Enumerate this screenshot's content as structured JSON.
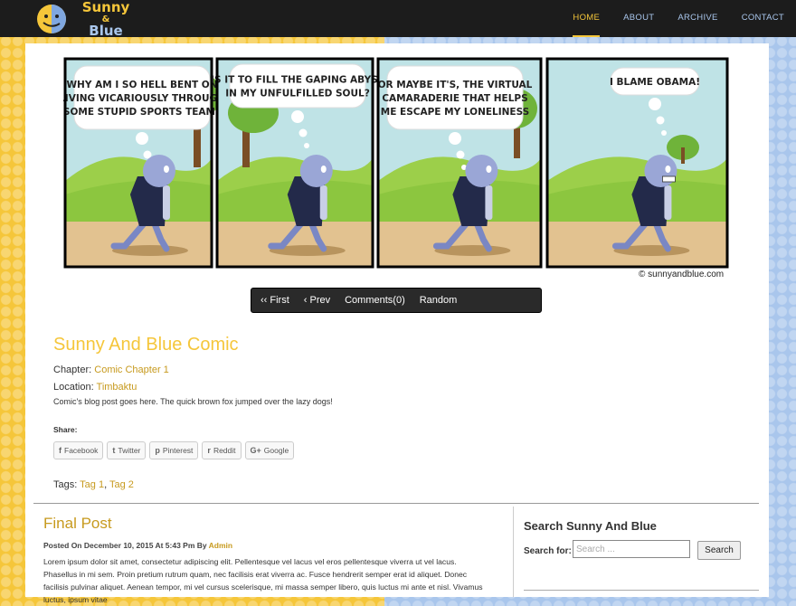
{
  "site": {
    "logo_line1": "Sunny",
    "logo_line2": "&",
    "logo_line3": "Blue"
  },
  "nav": {
    "items": [
      {
        "label": "HOME",
        "active": true
      },
      {
        "label": "ABOUT",
        "active": false
      },
      {
        "label": "ARCHIVE",
        "active": false
      },
      {
        "label": "CONTACT",
        "active": false
      }
    ]
  },
  "comic": {
    "panels": [
      {
        "lines": [
          "WHY AM I SO HELL BENT ON",
          "LIVING  VICARIOUSLY THROUGH",
          "SOME STUPID SPORTS TEAM?"
        ]
      },
      {
        "lines": [
          "IS IT TO FILL THE GAPING ABYSS",
          "IN MY UNFULFILLED SOUL?"
        ]
      },
      {
        "lines": [
          "OR MAYBE IT'S, THE VIRTUAL",
          "CAMARADERIE THAT HELPS",
          "ME ESCAPE MY LONELINESS"
        ]
      },
      {
        "lines": [
          "I BLAME OBAMA!"
        ]
      }
    ],
    "credit": "© sunnyandblue.com",
    "nav": {
      "first": "‹‹ First",
      "prev": "‹ Prev",
      "comments": "Comments(0)",
      "random": "Random"
    }
  },
  "post": {
    "title": "Sunny And Blue Comic",
    "chapter_label": "Chapter:",
    "chapter_value": "Comic Chapter 1",
    "location_label": "Location:",
    "location_value": "Timbaktu",
    "excerpt": "Comic's blog post goes here. The quick brown fox jumped over the lazy dogs!",
    "share_label": "Share:",
    "share_buttons": [
      {
        "label": "Facebook",
        "icon": "facebook-icon",
        "glyph": "f"
      },
      {
        "label": "Twitter",
        "icon": "twitter-icon",
        "glyph": "t"
      },
      {
        "label": "Pinterest",
        "icon": "pinterest-icon",
        "glyph": "p"
      },
      {
        "label": "Reddit",
        "icon": "reddit-icon",
        "glyph": "r"
      },
      {
        "label": "Google",
        "icon": "google-icon",
        "glyph": "G+"
      }
    ],
    "tags_label": "Tags:",
    "tags": [
      "Tag 1",
      "Tag 2"
    ]
  },
  "final_post": {
    "title": "Final Post",
    "posted_on": "Posted On December 10, 2015 At 5:43 Pm By",
    "author": "Admin",
    "body": "Lorem ipsum dolor sit amet, consectetur adipiscing elit. Pellentesque vel lacus vel eros pellentesque viverra ut vel lacus. Phasellus in mi sem. Proin pretium rutrum quam, nec facilisis erat viverra ac. Fusce hendrerit semper erat id aliquet. Donec facilisis pulvinar aliquet. Aenean tempor, mi vel cursus scelerisque, mi massa semper libero, quis luctus mi ante et nisl. Vivamus luctus, ipsum vitae"
  },
  "sidebar": {
    "title": "Search Sunny And Blue",
    "search_label": "Search for:",
    "search_placeholder": "Search ...",
    "search_button": "Search"
  },
  "colors": {
    "yellow": "#f5c63a",
    "blue": "#a9c6ec",
    "link_gold": "#c79a1e",
    "header_bg": "#1c1c1c"
  }
}
